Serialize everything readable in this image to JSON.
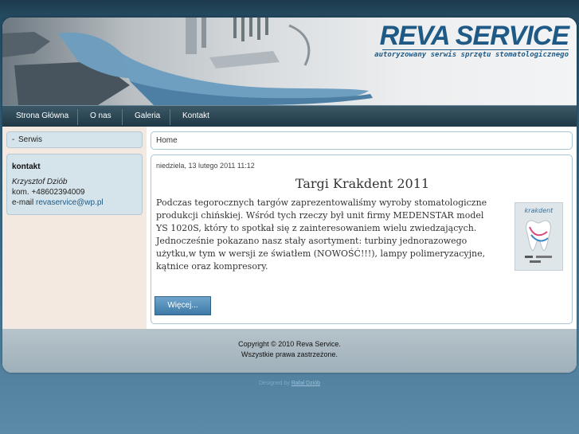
{
  "header": {
    "logo_title": "REVA SERVICE",
    "logo_subtitle": "autoryzowany serwis sprzętu stomatologicznego"
  },
  "nav": {
    "items": [
      "Strona Główna",
      "O nas",
      "Galeria",
      "Kontakt"
    ]
  },
  "sidebar": {
    "menu_label": "Serwis",
    "contact": {
      "heading": "kontakt",
      "name": "Krzysztof Dziób",
      "phone_label": "kom.",
      "phone": "+48602394009",
      "email_label": "e-mail",
      "email": "revaservice@wp.pl"
    }
  },
  "breadcrumb": {
    "home": "Home"
  },
  "article": {
    "date": "niedziela, 13 lutego 2011 11:12",
    "title": "Targi Krakdent 2011",
    "body": "Podczas tegorocznych targów zaprezentowaliśmy wyroby stomatologiczne produkcji chińskiej. Wśród tych rzeczy był unit firmy MEDENSTAR model YS 1020S, który to spotkał się z zainteresowaniem wielu zwiedzających. Jednocześnie pokazano nasz stały asortyment: turbiny jednorazowego użytku,w tym w wersji ze światłem (NOWOŚĆ!!!), lampy polimeryzacyjne, kątnice oraz kompresory.",
    "image_label": "krakdent",
    "more_button": "Więcej..."
  },
  "footer": {
    "copyright": "Copyright © 2010 Reva Service.",
    "rights": "Wszystkie prawa zastrzeżone.",
    "designed_by_label": "Designed by",
    "designer": "Rafał Dziób"
  },
  "colors": {
    "brand": "#1f5a86",
    "nav_bg": "#2b4653",
    "sidebar_bg": "#f4e9e0",
    "panel_bg": "#d5e3ea"
  }
}
